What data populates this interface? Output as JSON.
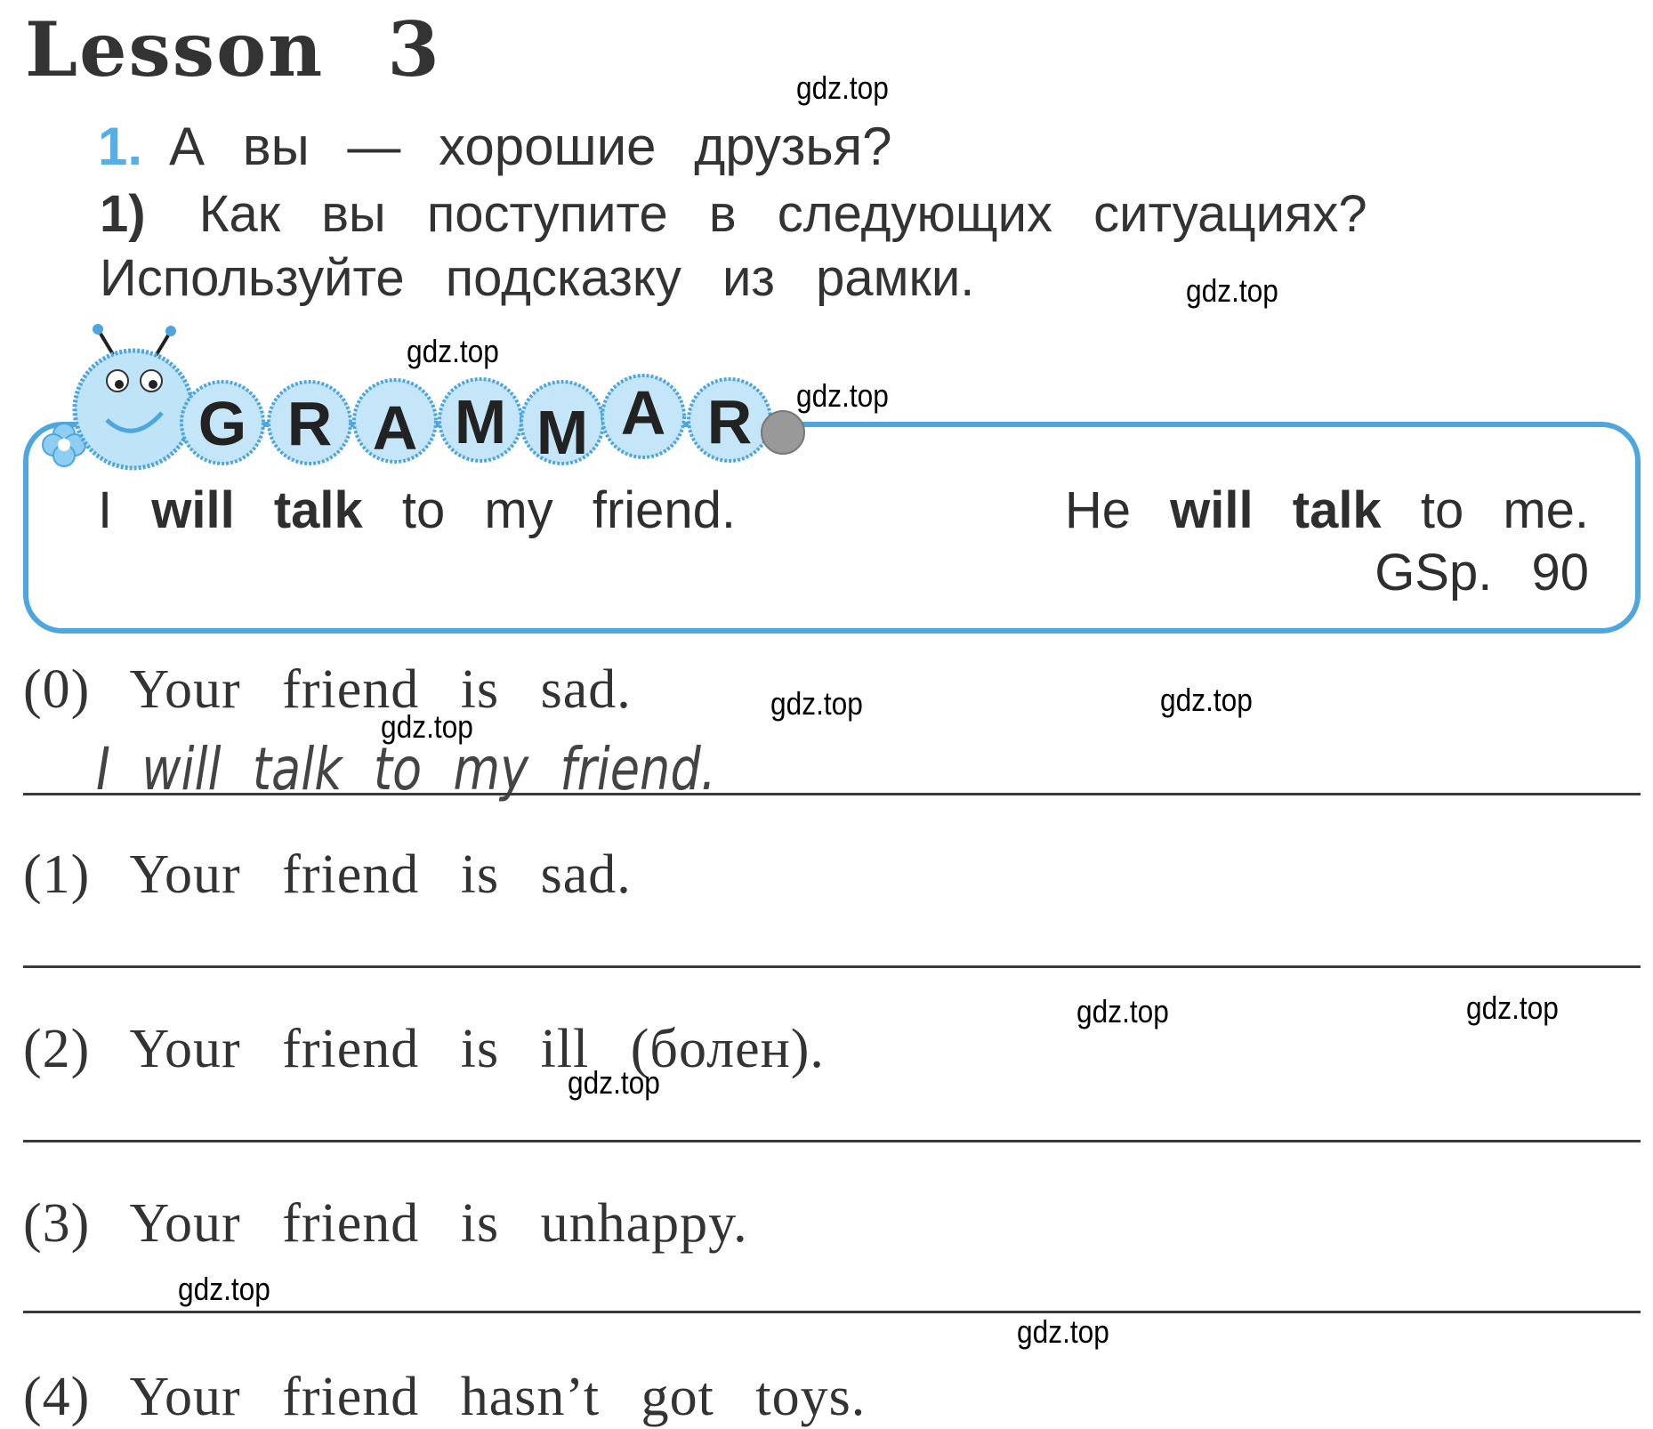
{
  "lesson_title": "Lesson 3",
  "exercise": {
    "number": "1.",
    "title": "А вы — хорошие друзья?",
    "sub_number": "1)",
    "instruction": "Как вы поступите в следующих ситуациях? Используйте подсказку из рамки."
  },
  "grammar_box": {
    "logo_letters": [
      "G",
      "R",
      "A",
      "M",
      "M",
      "A",
      "R"
    ],
    "example_left": {
      "pre": "I",
      "bold1": "will",
      "bold2": "talk",
      "post": "to my friend."
    },
    "example_right": {
      "pre": "He",
      "bold1": "will",
      "bold2": "talk",
      "post": "to me."
    },
    "reference": "GSp. 90",
    "border_color": "#4ea6e0"
  },
  "items": [
    {
      "label": "(0) Your friend is sad.",
      "answer": "I will talk to my friend."
    },
    {
      "label": "(1) Your friend is sad.",
      "answer": ""
    },
    {
      "label": "(2) Your friend is ill (болен).",
      "answer": ""
    },
    {
      "label": "(3) Your friend is unhappy.",
      "answer": ""
    },
    {
      "label": "(4) Your friend hasn’t got toys.",
      "answer": ""
    }
  ],
  "watermark": "gdz.top"
}
